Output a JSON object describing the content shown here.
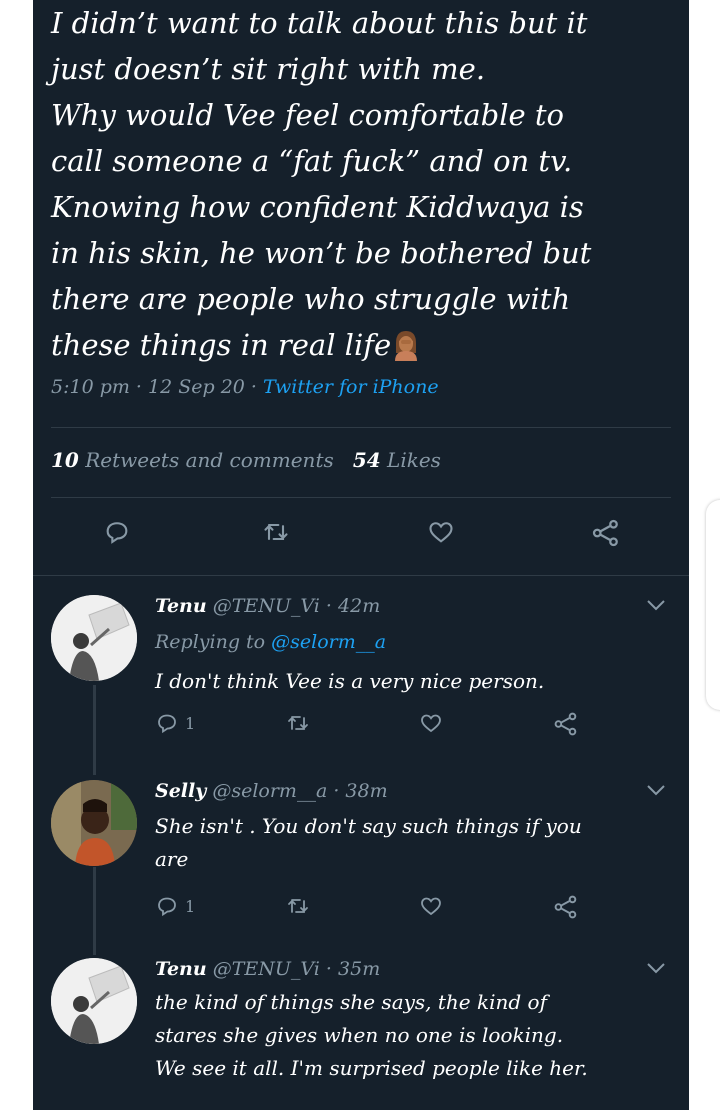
{
  "tweet": {
    "text": "I didn’t want to talk about this but it\njust doesn’t sit right with me.\nWhy would Vee feel comfortable to\ncall someone a “fat fuck” and on tv.\nKnowing how confident Kiddwaya is\nin his skin, he won’t be bothered but\nthere are people who struggle with\nthese things in real life",
    "emoji": "woman-facepalming-emoji",
    "time": "5:10 pm",
    "sep1": " · ",
    "date": "12 Sep 20",
    "sep2": " · ",
    "client": "Twitter for iPhone",
    "retweets_count": "10",
    "retweets_label": "Retweets and comments",
    "likes_count": "54",
    "likes_label": "Likes"
  },
  "replies": [
    {
      "name": "Tenu",
      "handle": "@TENU_Vi",
      "time": "42m",
      "replying_prefix": "Replying to",
      "replying_to": "@selorm__a",
      "text": "I don't think Vee is a very nice person.",
      "reply_count": "1",
      "avatar_icon": "avatar-photo"
    },
    {
      "name": "Selly",
      "handle": "@selorm__a",
      "time": "38m",
      "text": "She isn't . You don't say such things if you\nare",
      "reply_count": "1",
      "avatar_icon": "avatar-photo"
    },
    {
      "name": "Tenu",
      "handle": "@TENU_Vi",
      "time": "35m",
      "text": "the kind of things she says, the kind of\nstares she gives when no one is looking.\nWe see it all. I'm surprised people like her.",
      "avatar_icon": "avatar-photo"
    }
  ],
  "icons": {
    "reply": "reply-icon",
    "retweet": "retweet-icon",
    "like": "heart-icon",
    "share": "share-icon",
    "more": "chevron-down-icon"
  },
  "colors": {
    "background": "#15202b",
    "text": "#ffffff",
    "muted": "#8899a6",
    "link": "#1da1f2",
    "divider": "#2f3b46"
  }
}
